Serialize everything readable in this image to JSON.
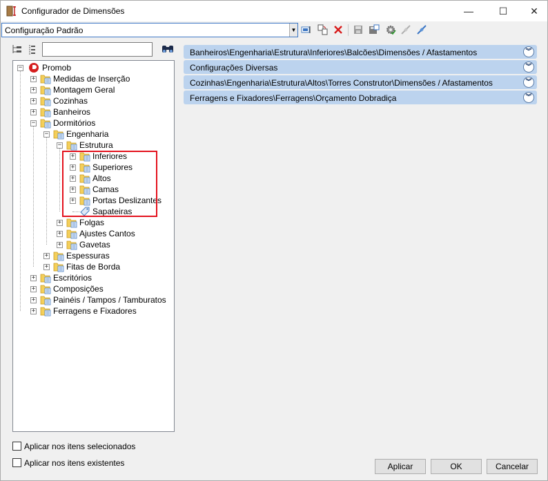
{
  "window": {
    "title": "Configurador de Dimensões",
    "minimize_glyph": "—",
    "maximize_glyph": "☐",
    "close_glyph": "✕"
  },
  "toolbar": {
    "config_value": "Configuração Padrão",
    "icons": [
      "edit-config-icon",
      "copy-config-icon",
      "delete-icon",
      "save-icon",
      "save-as-icon",
      "settings-icon",
      "disconnect-icon",
      "connect-icon"
    ]
  },
  "tree": {
    "search_value": "",
    "root": "Promob",
    "items": [
      {
        "label": "Medidas de Inserção"
      },
      {
        "label": "Montagem Geral"
      },
      {
        "label": "Cozinhas"
      },
      {
        "label": "Banheiros"
      },
      {
        "label": "Dormitórios"
      },
      {
        "label": "Engenharia"
      },
      {
        "label": "Estrutura"
      },
      {
        "label": "Inferiores"
      },
      {
        "label": "Superiores"
      },
      {
        "label": "Altos"
      },
      {
        "label": "Camas"
      },
      {
        "label": "Portas Deslizantes"
      },
      {
        "label": "Sapateiras"
      },
      {
        "label": "Folgas"
      },
      {
        "label": "Ajustes Cantos"
      },
      {
        "label": "Gavetas"
      },
      {
        "label": "Espessuras"
      },
      {
        "label": "Fitas de Borda"
      },
      {
        "label": "Escritórios"
      },
      {
        "label": "Composições"
      },
      {
        "label": "Painéis / Tampos / Tamburatos"
      },
      {
        "label": "Ferragens e Fixadores"
      }
    ]
  },
  "groups": [
    {
      "title": "Banheiros\\Engenharia\\Estrutura\\Inferiores\\Balcões\\Dimensões / Afastamentos"
    },
    {
      "title": "Configurações Diversas"
    },
    {
      "title": "Cozinhas\\Engenharia\\Estrutura\\Altos\\Torres Construtor\\Dimensões / Afastamentos"
    },
    {
      "title": "Ferragens e Fixadores\\Ferragens\\Orçamento Dobradiça"
    }
  ],
  "group_expand_glyph": "︾",
  "options": {
    "apply_selected": "Aplicar nos itens selecionados",
    "apply_existing": "Aplicar nos itens existentes"
  },
  "buttons": {
    "apply": "Aplicar",
    "ok": "OK",
    "cancel": "Cancelar"
  },
  "colors": {
    "group_header": "#bcd3ee",
    "highlight": "#e3101b",
    "folder": "#f2c94c"
  }
}
